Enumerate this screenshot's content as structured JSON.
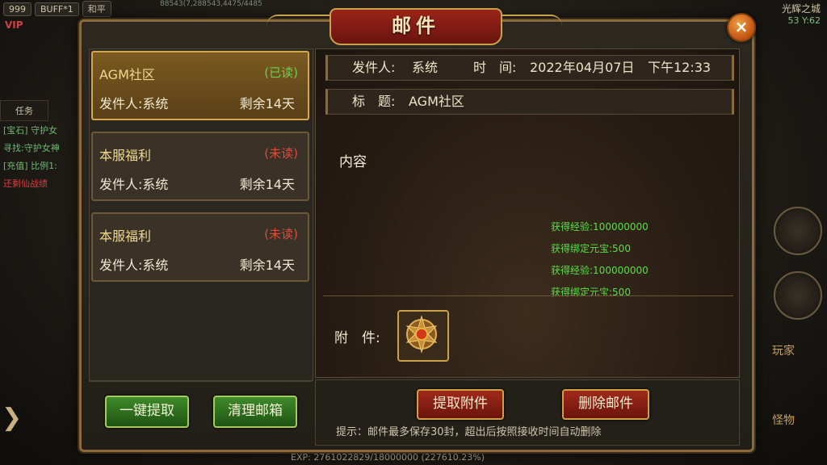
{
  "hud": {
    "level": "999",
    "vip": "VIP",
    "buff": "BUFF*1",
    "mode": "和平",
    "stats": "88543(7,288543,4475/4485",
    "map_name": "光辉之城",
    "coords": "53 Y:62",
    "quest_tab": "任务",
    "quest_lines": [
      "[宝石] 守护女",
      "寻找:守护女神",
      "[充值] 比例1:",
      "还剩仙战绩"
    ],
    "right_labels": [
      "玩家",
      "怪物"
    ],
    "exp": "EXP: 2761022829/18000000 (227610.23%)"
  },
  "dialog": {
    "title": "邮件",
    "close_label": "×",
    "mails": [
      {
        "title": "AGM社区",
        "status": "(已读)",
        "sender": "发件人:系统",
        "remain": "剩余14天"
      },
      {
        "title": "本服福利",
        "status": "(未读)",
        "sender": "发件人:系统",
        "remain": "剩余14天"
      },
      {
        "title": "本服福利",
        "status": "(未读)",
        "sender": "发件人:系统",
        "remain": "剩余14天"
      }
    ],
    "collect_all_button": "一键提取",
    "clear_mailbox_button": "清理邮箱",
    "detail": {
      "sender_label": "发件人:",
      "sender_value": "系统",
      "time_label": "时　间:",
      "time_value": "2022年04月07日",
      "time_clock": "下午12:33",
      "subject_label": "标　题:",
      "subject_value": "AGM社区",
      "content": "内容",
      "rewards": [
        "获得经验:100000000",
        "获得绑定元宝:500",
        "获得经验:100000000",
        "获得绑定元宝:500"
      ],
      "attachment_label": "附　件:"
    },
    "extract_attachment_button": "提取附件",
    "delete_mail_button": "删除邮件",
    "tip": "提示：邮件最多保存30封，超出后按照接收时间自动删除"
  }
}
